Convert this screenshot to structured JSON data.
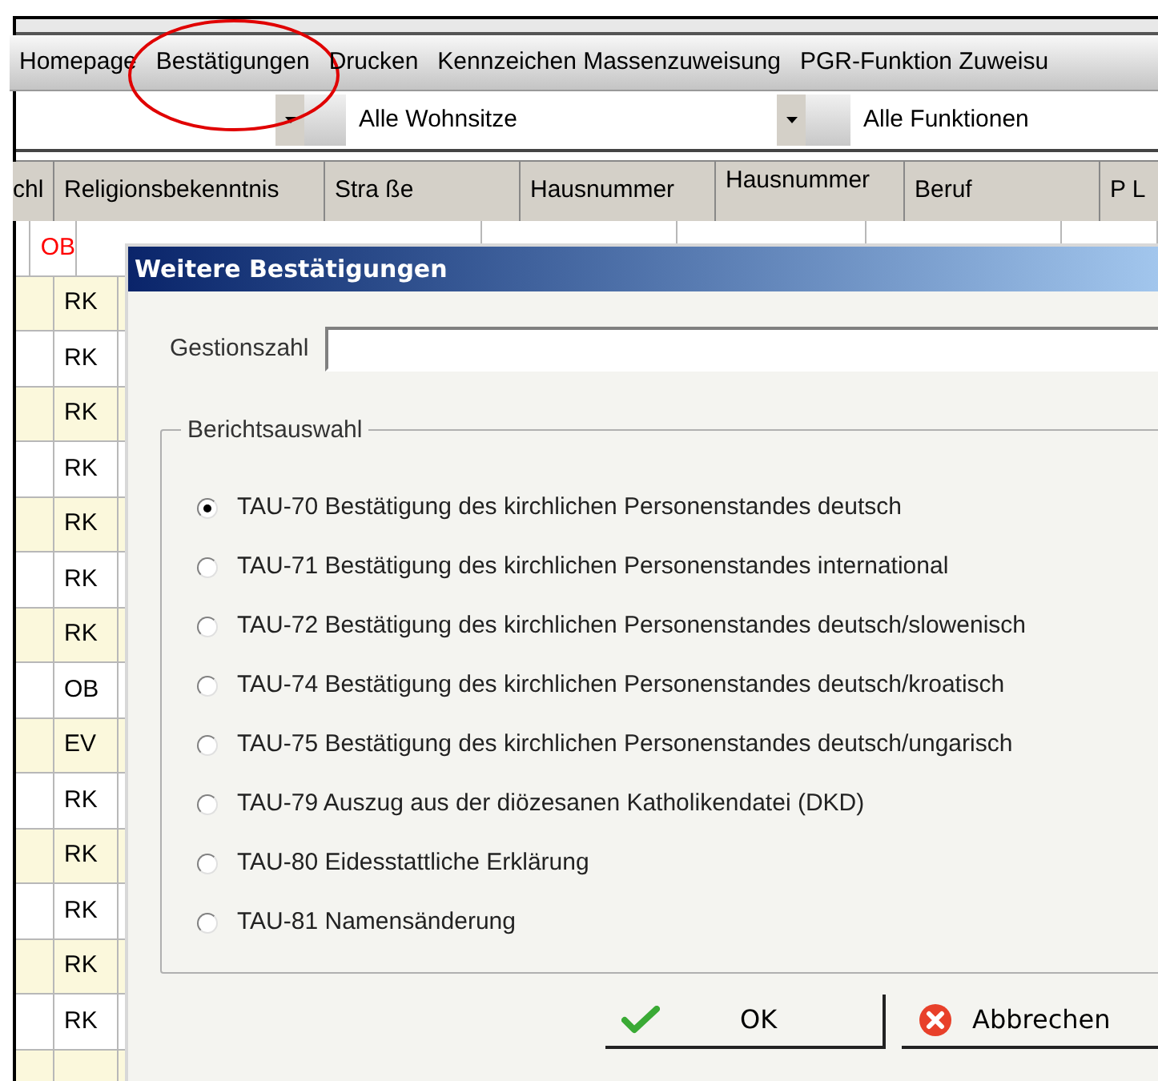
{
  "menu": [
    {
      "label": "Homepage",
      "circled": false
    },
    {
      "label": "Bestätigungen",
      "circled": true
    },
    {
      "label": "Drucken",
      "circled": false
    },
    {
      "label": "Kennzeichen Massenzuweisung",
      "circled": false
    },
    {
      "label": "PGR-Funktion Zuweisu",
      "circled": false
    }
  ],
  "filters": [
    "Alle Wohnsitze",
    "Alle Funktionen"
  ],
  "table": {
    "columns": [
      "chl",
      "Religionsbekenntnis",
      "Stra ße",
      "Hausnummer",
      "Hausnummer",
      "Beruf",
      "P L"
    ],
    "rows": [
      {
        "religion": "OB",
        "color": "#ff0000"
      },
      {
        "religion": "RK",
        "color": "#000000"
      },
      {
        "religion": "RK",
        "color": "#000000"
      },
      {
        "religion": "RK",
        "color": "#000000"
      },
      {
        "religion": "RK",
        "color": "#000000"
      },
      {
        "religion": "RK",
        "color": "#000000"
      },
      {
        "religion": "RK",
        "color": "#000000"
      },
      {
        "religion": "RK",
        "color": "#000000"
      },
      {
        "religion": "OB",
        "color": "#000000"
      },
      {
        "religion": "EV",
        "color": "#000000"
      },
      {
        "religion": "RK",
        "color": "#000000"
      },
      {
        "religion": "RK",
        "color": "#000000"
      },
      {
        "religion": "RK",
        "color": "#000000"
      },
      {
        "religion": "RK",
        "color": "#000000"
      },
      {
        "religion": "RK",
        "color": "#000000"
      }
    ]
  },
  "dialog": {
    "title": "Weitere Bestätigungen",
    "field_label": "Gestionszahl",
    "group_label": "Berichtsauswahl",
    "options": [
      {
        "label": "TAU-70 Bestätigung des kirchlichen Personenstandes deutsch",
        "selected": true
      },
      {
        "label": "TAU-71 Bestätigung des kirchlichen Personenstandes international",
        "selected": false
      },
      {
        "label": "TAU-72 Bestätigung des kirchlichen Personenstandes deutsch/slowenisch",
        "selected": false
      },
      {
        "label": "TAU-74 Bestätigung des kirchlichen Personenstandes deutsch/kroatisch",
        "selected": false
      },
      {
        "label": "TAU-75 Bestätigung des kirchlichen Personenstandes deutsch/ungarisch",
        "selected": false
      },
      {
        "label": "TAU-79 Auszug aus der diözesanen Katholikendatei (DKD)",
        "selected": false
      },
      {
        "label": "TAU-80 Eidesstattliche Erklärung",
        "selected": false
      },
      {
        "label": "TAU-81 Namensänderung",
        "selected": false
      }
    ],
    "buttons": [
      {
        "label": "OK",
        "kind": "ok"
      },
      {
        "label": "Abbrechen",
        "kind": "cancel"
      }
    ]
  }
}
